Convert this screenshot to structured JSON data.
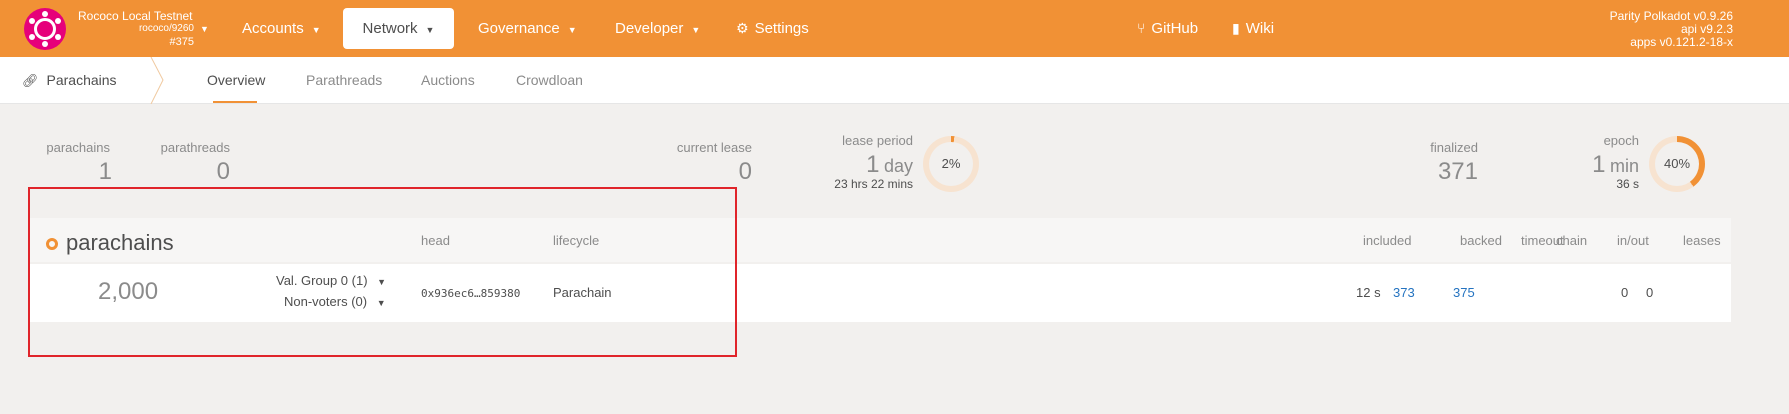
{
  "topbar": {
    "chain_name": "Rococo Local Testnet",
    "chain_runtime": "rococo/9260",
    "chain_block": "#375",
    "nav": [
      {
        "label": "Accounts",
        "has_caret": true
      },
      {
        "label": "Network",
        "has_caret": true,
        "active": true
      },
      {
        "label": "Governance",
        "has_caret": true
      },
      {
        "label": "Developer",
        "has_caret": true
      },
      {
        "label": "Settings",
        "icon": "gear-icon"
      }
    ],
    "links": [
      {
        "label": "GitHub",
        "icon": "branch-icon"
      },
      {
        "label": "Wiki",
        "icon": "book-icon"
      }
    ],
    "version_lines": [
      "Parity Polkadot v0.9.26",
      "api v9.2.3",
      "apps v0.121.2-18-x"
    ]
  },
  "subnav": {
    "section": "Parachains",
    "tabs": [
      "Overview",
      "Parathreads",
      "Auctions",
      "Crowdloan"
    ],
    "active_tab": "Overview"
  },
  "summary": {
    "parachains_label": "parachains",
    "parachains_value": "1",
    "parathreads_label": "parathreads",
    "parathreads_value": "0",
    "current_lease_label": "current lease",
    "current_lease_value": "0",
    "lease_period_label": "lease period",
    "lease_period_value": "1",
    "lease_period_unit": "day",
    "lease_period_remaining": "23 hrs 22 mins",
    "lease_period_percent_label": "2%",
    "lease_period_progress": 0.02,
    "finalized_label": "finalized",
    "finalized_value": "371",
    "epoch_label": "epoch",
    "epoch_value": "1",
    "epoch_unit": "min",
    "epoch_remaining": "36 s",
    "epoch_percent_label": "40%",
    "epoch_progress": 0.4
  },
  "table": {
    "title": "parachains",
    "headers": {
      "head": "head",
      "lifecycle": "lifecycle",
      "included": "included",
      "backed": "backed",
      "timeout": "timeout",
      "chain": "chain",
      "in_out": "in/out",
      "leases": "leases"
    },
    "rows": [
      {
        "id": "2,000",
        "val_group": "Val. Group 0 (1)",
        "non_voters": "Non-voters (0)",
        "head": "0x936ec6…859380",
        "lifecycle": "Parachain",
        "last_time": "12 s",
        "included": "373",
        "backed": "375",
        "in": "0",
        "out": "0"
      }
    ]
  },
  "colors": {
    "accent": "#f19135",
    "logo": "#e6007a",
    "link": "#2473c0",
    "highlight": "#e0242a"
  }
}
